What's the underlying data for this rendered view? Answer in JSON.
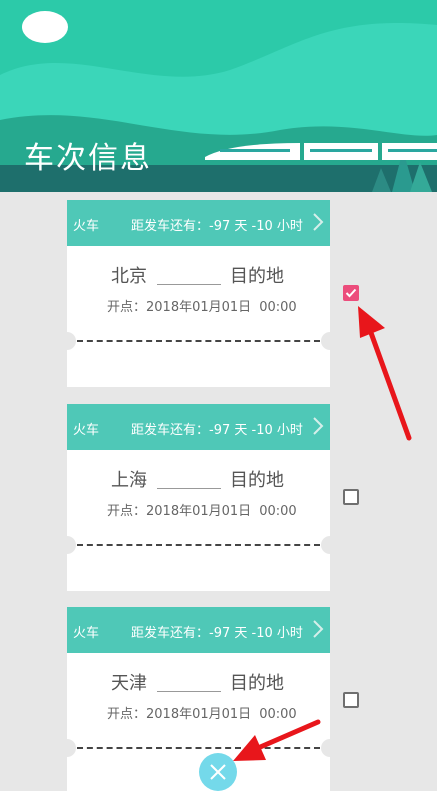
{
  "header": {
    "title": "车次信息"
  },
  "tickets": [
    {
      "type": "火车",
      "countdown": "距发车还有：-97 天 -10 小时",
      "from": "北京",
      "to": "目的地",
      "depart_label": "开点：",
      "depart_date": "2018年01月01日",
      "depart_time": "00:00",
      "checked": true
    },
    {
      "type": "火车",
      "countdown": "距发车还有：-97 天 -10 小时",
      "from": "上海",
      "to": "目的地",
      "depart_label": "开点：",
      "depart_date": "2018年01月01日",
      "depart_time": "00:00",
      "checked": false
    },
    {
      "type": "火车",
      "countdown": "距发车还有：-97 天 -10 小时",
      "from": "天津",
      "to": "目的地",
      "depart_label": "开点：",
      "depart_date": "2018年01月01日",
      "depart_time": "00:00",
      "checked": false
    }
  ],
  "icons": {
    "header_art": "train-landscape-icon",
    "select": "checkbox-icon",
    "delete": "close-icon",
    "detail": "chevron-right-icon",
    "annotation": "red-arrow-icon"
  },
  "colors": {
    "header": "#2fc4a7",
    "ticket_head": "#4fc8b7",
    "checkbox_checked": "#ec4d7c",
    "fab": "#74d9ea",
    "arrow": "#e8161b"
  }
}
